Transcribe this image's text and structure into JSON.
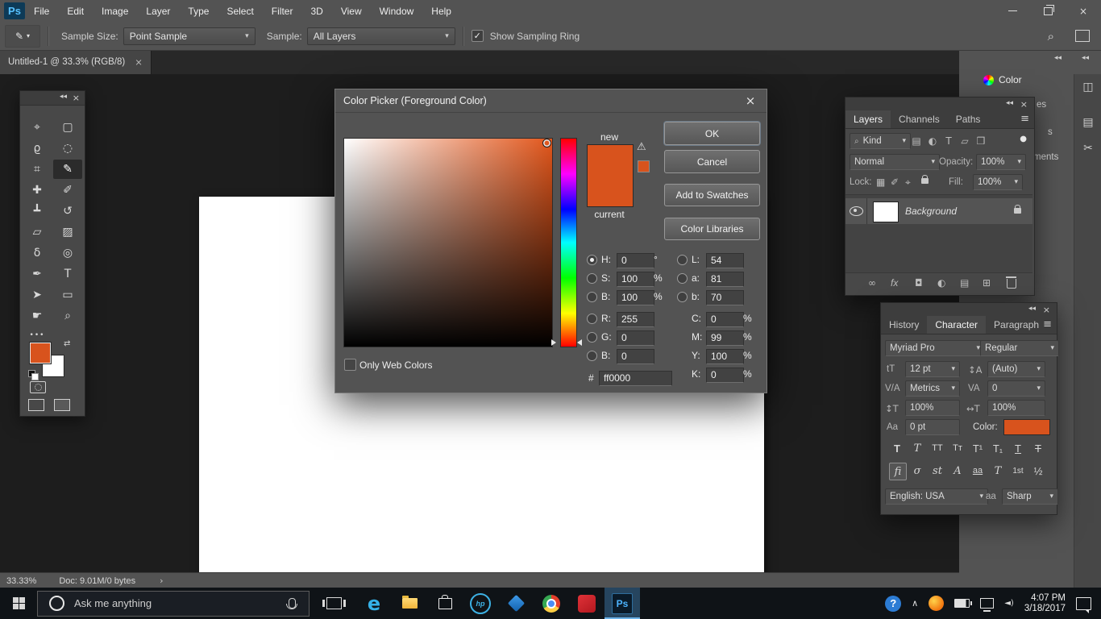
{
  "icons": {
    "dropdown": "▾",
    "check": "✓",
    "close": "×",
    "menu": "≡",
    "search": "⌕",
    "collapse": "◂◂",
    "chevron_right": "›",
    "chevron_up": "∧",
    "warning": "⚠",
    "swap_arrows": "⇄",
    "ellipsis": "•••",
    "circle": "●",
    "eyedropper": "✎",
    "help": "?",
    "volume": "◄)"
  },
  "menu": {
    "logo": "Ps",
    "items": [
      "File",
      "Edit",
      "Image",
      "Layer",
      "Type",
      "Select",
      "Filter",
      "3D",
      "View",
      "Window",
      "Help"
    ]
  },
  "options_bar": {
    "sample_size_label": "Sample Size:",
    "sample_size_value": "Point Sample",
    "sample_label": "Sample:",
    "sample_value": "All Layers",
    "sampling_ring_label": "Show Sampling Ring"
  },
  "document_tab": {
    "title": "Untitled-1 @ 33.3% (RGB/8)"
  },
  "toolbar": {
    "tools": [
      {
        "name": "move-tool",
        "glyph": "⌖"
      },
      {
        "name": "rectangular-marquee-tool",
        "glyph": "▢"
      },
      {
        "name": "lasso-tool",
        "glyph": "ϱ"
      },
      {
        "name": "quick-selection-tool",
        "glyph": "◌"
      },
      {
        "name": "crop-tool",
        "glyph": "⌗"
      },
      {
        "name": "eyedropper-tool",
        "glyph": "✎"
      },
      {
        "name": "spot-healing-brush-tool",
        "glyph": "✚"
      },
      {
        "name": "brush-tool",
        "glyph": "✐"
      },
      {
        "name": "clone-stamp-tool",
        "glyph": "┻"
      },
      {
        "name": "history-brush-tool",
        "glyph": "↺"
      },
      {
        "name": "eraser-tool",
        "glyph": "▱"
      },
      {
        "name": "gradient-tool",
        "glyph": "▨"
      },
      {
        "name": "blur-tool",
        "glyph": "δ"
      },
      {
        "name": "dodge-tool",
        "glyph": "◎"
      },
      {
        "name": "pen-tool",
        "glyph": "✒"
      },
      {
        "name": "type-tool",
        "glyph": "T"
      },
      {
        "name": "path-selection-tool",
        "glyph": "➤"
      },
      {
        "name": "rectangle-tool",
        "glyph": "▭"
      },
      {
        "name": "hand-tool",
        "glyph": "☛"
      },
      {
        "name": "zoom-tool",
        "glyph": "⌕"
      }
    ]
  },
  "color_picker": {
    "title": "Color Picker (Foreground Color)",
    "new_label": "new",
    "current_label": "current",
    "swatch_color": "#d8531d",
    "ok": "OK",
    "cancel": "Cancel",
    "add_to_swatches": "Add to Swatches",
    "color_libraries": "Color Libraries",
    "only_web_colors": "Only Web Colors",
    "hex_prefix": "#",
    "hex_value": "ff0000",
    "fields": {
      "h": {
        "label": "H:",
        "value": "0",
        "unit": "°"
      },
      "s": {
        "label": "S:",
        "value": "100",
        "unit": "%"
      },
      "b": {
        "label": "B:",
        "value": "100",
        "unit": "%"
      },
      "r": {
        "label": "R:",
        "value": "255",
        "unit": ""
      },
      "g": {
        "label": "G:",
        "value": "0",
        "unit": ""
      },
      "b2": {
        "label": "B:",
        "value": "0",
        "unit": ""
      },
      "l": {
        "label": "L:",
        "value": "54",
        "unit": ""
      },
      "a": {
        "label": "a:",
        "value": "81",
        "unit": ""
      },
      "b3": {
        "label": "b:",
        "value": "70",
        "unit": ""
      },
      "c": {
        "label": "C:",
        "value": "0",
        "unit": "%"
      },
      "m": {
        "label": "M:",
        "value": "99",
        "unit": "%"
      },
      "y": {
        "label": "Y:",
        "value": "100",
        "unit": "%"
      },
      "k": {
        "label": "K:",
        "value": "0",
        "unit": "%"
      }
    }
  },
  "layers_panel": {
    "tabs": [
      "Layers",
      "Channels",
      "Paths"
    ],
    "kind_label": "Kind",
    "filter_icons": [
      "▤",
      "◐",
      "T",
      "▱",
      "❒"
    ],
    "blend_mode": "Normal",
    "opacity_label": "Opacity:",
    "opacity_value": "100%",
    "lock_label": "Lock:",
    "lock_icons": [
      "▦",
      "✐",
      "⌖"
    ],
    "fill_label": "Fill:",
    "fill_value": "100%",
    "layer_name": "Background",
    "bottom_icons": [
      "∞",
      "fx",
      "◘",
      "◐",
      "▤",
      "⊞"
    ]
  },
  "character_panel": {
    "tabs": [
      "History",
      "Character",
      "Paragraph"
    ],
    "font_family": "Myriad Pro",
    "font_style": "Regular",
    "font_size": "12 pt",
    "leading": "(Auto)",
    "kerning": "Metrics",
    "tracking": "0",
    "vertical_scale": "100%",
    "horizontal_scale": "100%",
    "baseline_shift": "0 pt",
    "color_label": "Color:",
    "swatch_color": "#d8531d",
    "language": "English: USA",
    "anti_alias": "Sharp",
    "icons": {
      "size": "tT",
      "leading": "↕A",
      "kerning": "V/A",
      "tracking": "VA",
      "v_scale": "↕T",
      "h_scale": "↔T",
      "baseline": "Aa",
      "anti_alias": "aa"
    },
    "style_buttons": [
      "T",
      "T",
      "TT",
      "Tᴛ",
      "T¹",
      "T₁",
      "T",
      "T"
    ],
    "opentype_buttons": [
      "fi",
      "σ",
      "st",
      "A",
      "aa",
      "T",
      "1st",
      "½"
    ]
  },
  "dock": {
    "color_panel_label": "Color",
    "strip_icons": [
      "◫",
      "▤",
      "✂"
    ],
    "fragments": [
      "es",
      "s",
      "ments"
    ]
  },
  "status_bar": {
    "zoom": "33.33%",
    "doc_info": "Doc: 9.01M/0 bytes"
  },
  "taskbar": {
    "search_placeholder": "Ask me anything",
    "edge": "e",
    "hp": "hp",
    "ps": "Ps",
    "time": "4:07 PM",
    "date": "3/18/2017"
  }
}
